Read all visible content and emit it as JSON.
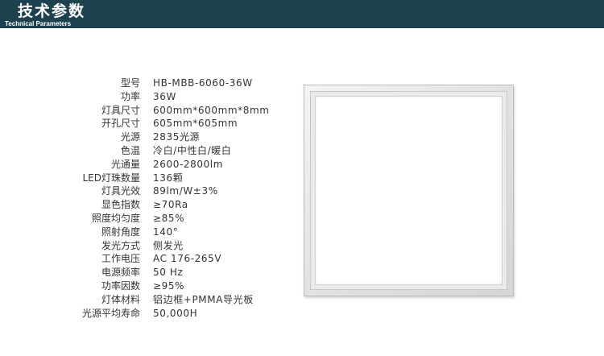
{
  "header": {
    "title": "技术参数",
    "subtitle": "Technical Parameters",
    "background_color": "#1e4150"
  },
  "specs": [
    {
      "label": "型号",
      "value": "HB-MBB-6060-36W"
    },
    {
      "label": "功率",
      "value": "36W"
    },
    {
      "label": "灯具尺寸",
      "value": "600mm*600mm*8mm"
    },
    {
      "label": "开孔尺寸",
      "value": "605mm*605mm"
    },
    {
      "label": "光源",
      "value": "2835光源"
    },
    {
      "label": "色温",
      "value": "冷白/中性白/暖白"
    },
    {
      "label": "光通量",
      "value": "2600-2800lm"
    },
    {
      "label": "LED灯珠数量",
      "value": "136颗"
    },
    {
      "label": "灯具光效",
      "value": "89lm/W±3%"
    },
    {
      "label": "显色指数",
      "value": "≥70Ra"
    },
    {
      "label": "照度均匀度",
      "value": "≥85%"
    },
    {
      "label": "照射角度",
      "value": "140°"
    },
    {
      "label": "发光方式",
      "value": "侧发光"
    },
    {
      "label": "工作电压",
      "value": "AC 176-265V"
    },
    {
      "label": "电源频率",
      "value": "50 Hz"
    },
    {
      "label": "功率因数",
      "value": "≥95%"
    },
    {
      "label": "灯体材料",
      "value": "铝边框+PMMA导光板"
    },
    {
      "label": "光源平均寿命",
      "value": "50,000H"
    }
  ]
}
